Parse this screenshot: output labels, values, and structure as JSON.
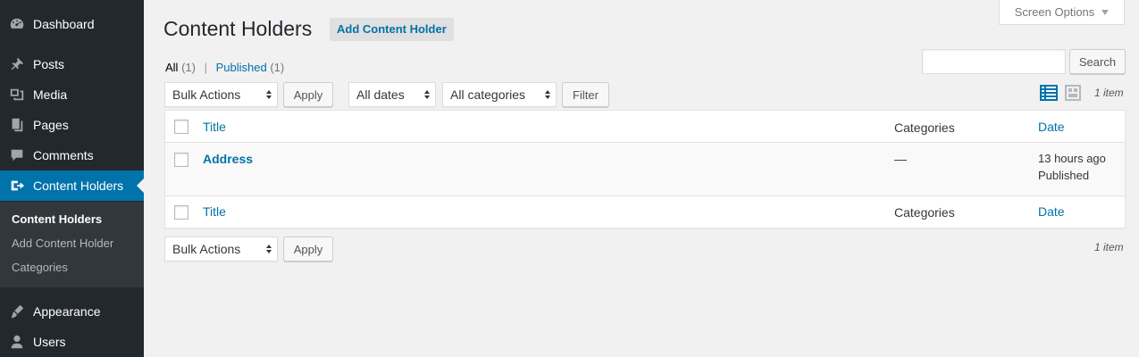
{
  "sidebar": {
    "items": [
      {
        "label": "Dashboard",
        "icon": "dashboard-icon"
      },
      {
        "label": "Posts",
        "icon": "pin-icon"
      },
      {
        "label": "Media",
        "icon": "media-icon"
      },
      {
        "label": "Pages",
        "icon": "pages-icon"
      },
      {
        "label": "Comments",
        "icon": "comment-icon"
      },
      {
        "label": "Content Holders",
        "icon": "content-holders-icon"
      },
      {
        "label": "Appearance",
        "icon": "paintbrush-icon"
      },
      {
        "label": "Users",
        "icon": "user-icon"
      }
    ],
    "submenu": [
      {
        "label": "Content Holders"
      },
      {
        "label": "Add Content Holder"
      },
      {
        "label": "Categories"
      }
    ]
  },
  "header": {
    "title": "Content Holders",
    "add_new_label": "Add Content Holder",
    "screen_options_label": "Screen Options"
  },
  "views": {
    "all_label": "All",
    "all_count": "(1)",
    "separator": "|",
    "published_label": "Published",
    "published_count": "(1)"
  },
  "search": {
    "value": "",
    "button_label": "Search"
  },
  "tablenav_top": {
    "bulk_actions": "Bulk Actions",
    "apply_label": "Apply",
    "dates_filter": "All dates",
    "categories_filter": "All categories",
    "filter_label": "Filter",
    "items_count": "1 item"
  },
  "table": {
    "columns": {
      "title": "Title",
      "categories": "Categories",
      "date": "Date"
    },
    "rows": [
      {
        "title": "Address",
        "categories": "—",
        "date": "13 hours ago",
        "status": "Published"
      }
    ]
  },
  "tablenav_bottom": {
    "bulk_actions": "Bulk Actions",
    "apply_label": "Apply",
    "items_count": "1 item"
  },
  "colors": {
    "sidebar_bg": "#23282d",
    "accent": "#0073aa",
    "page_bg": "#f1f1f1"
  }
}
